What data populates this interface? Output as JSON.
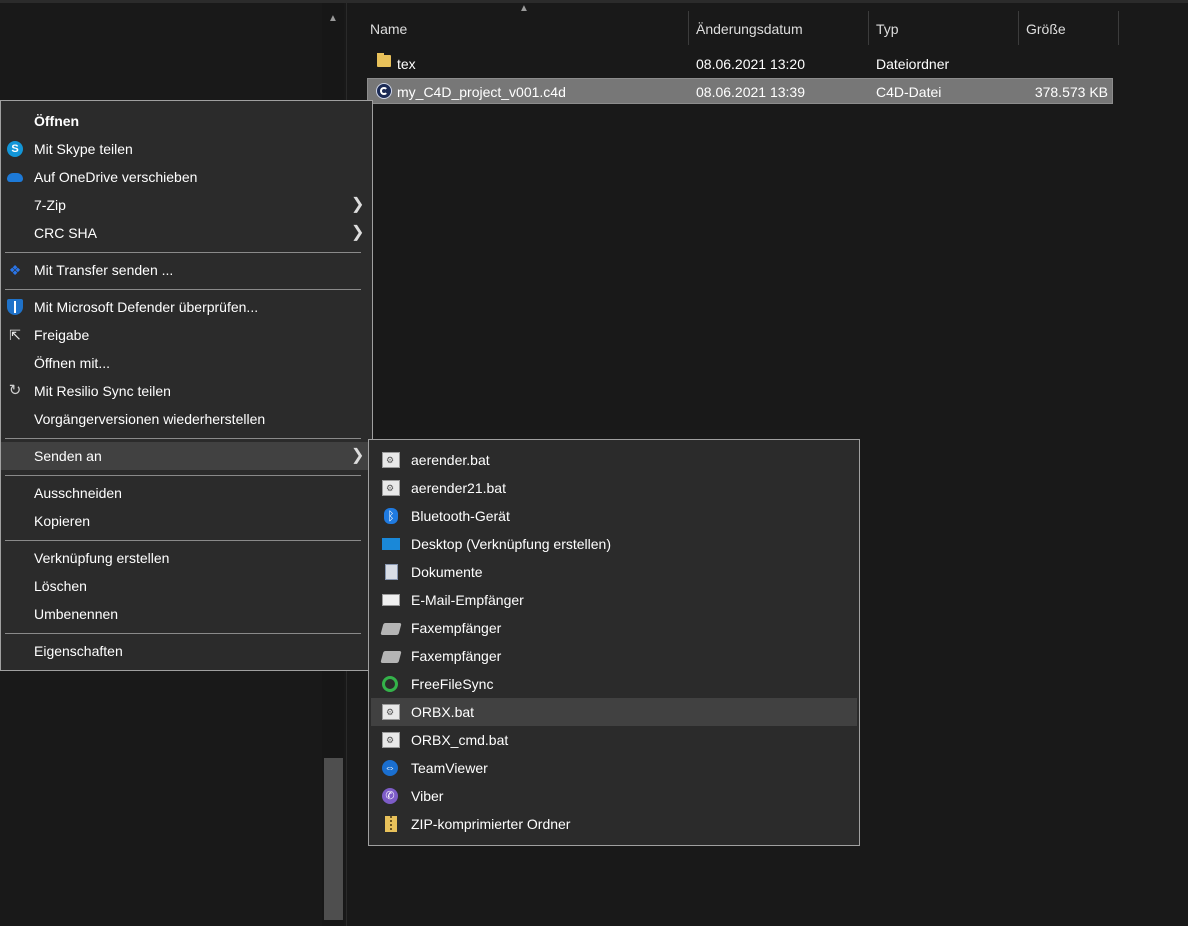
{
  "file_list": {
    "columns": {
      "name": "Name",
      "date": "Änderungsdatum",
      "type": "Typ",
      "size": "Größe"
    },
    "rows": [
      {
        "name": "tex",
        "date": "08.06.2021 13:20",
        "type": "Dateiordner",
        "size": "",
        "icon": "folder-icon"
      },
      {
        "name": "my_C4D_project_v001.c4d",
        "date": "08.06.2021 13:39",
        "type": "C4D-Datei",
        "size": "378.573 KB",
        "icon": "c4d-file-icon",
        "selected": true
      }
    ]
  },
  "context_menu": {
    "items": [
      {
        "label": "Öffnen"
      },
      {
        "label": "Mit Skype teilen",
        "icon": "skype-icon"
      },
      {
        "label": "Auf OneDrive verschieben",
        "icon": "onedrive-icon"
      },
      {
        "label": "7-Zip",
        "has_submenu": true
      },
      {
        "label": "CRC SHA",
        "has_submenu": true
      },
      {
        "label": "Mit Transfer senden ...",
        "icon": "dropbox-icon"
      },
      {
        "label": "Mit Microsoft Defender überprüfen...",
        "icon": "defender-shield-icon"
      },
      {
        "label": "Freigabe",
        "icon": "share-icon"
      },
      {
        "label": "Öffnen mit..."
      },
      {
        "label": "Mit Resilio Sync teilen",
        "icon": "resilio-sync-icon"
      },
      {
        "label": "Vorgängerversionen wiederherstellen"
      },
      {
        "label": "Senden an",
        "has_submenu": true,
        "highlighted": true
      },
      {
        "label": "Ausschneiden"
      },
      {
        "label": "Kopieren"
      },
      {
        "label": "Verknüpfung erstellen"
      },
      {
        "label": "Löschen"
      },
      {
        "label": "Umbenennen"
      },
      {
        "label": "Eigenschaften"
      }
    ]
  },
  "send_to_menu": {
    "items": [
      {
        "label": "aerender.bat",
        "icon": "batch-file-icon"
      },
      {
        "label": "aerender21.bat",
        "icon": "batch-file-icon"
      },
      {
        "label": "Bluetooth-Gerät",
        "icon": "bluetooth-icon"
      },
      {
        "label": "Desktop (Verknüpfung erstellen)",
        "icon": "desktop-icon"
      },
      {
        "label": "Dokumente",
        "icon": "documents-icon"
      },
      {
        "label": "E-Mail-Empfänger",
        "icon": "mail-icon"
      },
      {
        "label": "Faxempfänger",
        "icon": "fax-icon"
      },
      {
        "label": "Faxempfänger",
        "icon": "fax-icon"
      },
      {
        "label": "FreeFileSync",
        "icon": "freefilesync-icon"
      },
      {
        "label": "ORBX.bat",
        "icon": "batch-file-icon",
        "highlighted": true
      },
      {
        "label": "ORBX_cmd.bat",
        "icon": "batch-file-icon"
      },
      {
        "label": "TeamViewer",
        "icon": "teamviewer-icon"
      },
      {
        "label": "Viber",
        "icon": "viber-icon"
      },
      {
        "label": "ZIP-komprimierter Ordner",
        "icon": "zip-folder-icon"
      }
    ]
  }
}
